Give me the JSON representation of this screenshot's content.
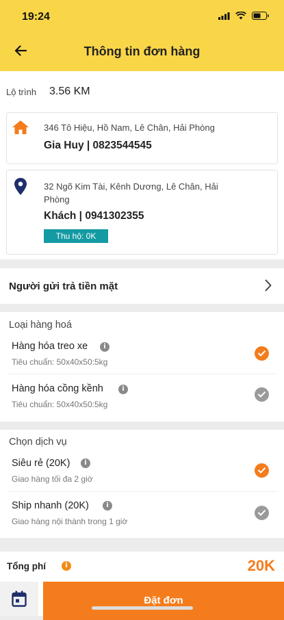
{
  "status_bar": {
    "time": "19:24"
  },
  "header": {
    "title": "Thông tin đơn hàng"
  },
  "route": {
    "label": "Lộ trình",
    "distance": "3.56 KM"
  },
  "pickup": {
    "address": "346 Tô Hiệu, Hồ Nam, Lê Chân, Hải Phòng",
    "contact": "Gia Huy | 0823544545",
    "icon": "home-icon"
  },
  "dropoff": {
    "address_line1": "32 Ngõ Kim Tài, Kênh Dương, Lê Chân, Hải",
    "address_line2": "Phòng",
    "contact": "Khách  | 0941302355",
    "cod_badge": "Thu hộ:  0K",
    "icon": "location-pin-icon"
  },
  "payment": {
    "label": "Người gửi trả tiền mặt"
  },
  "goods": {
    "title": "Loại hàng hoá",
    "options": [
      {
        "title": "Hàng hóa treo xe",
        "sub": "Tiêu chuẩn: 50x40x50:5kg",
        "selected": true
      },
      {
        "title": "Hàng hóa cồng kềnh",
        "sub": "Tiêu chuẩn: 50x40x50:5kg",
        "selected": false
      }
    ]
  },
  "service": {
    "title": "Chọn dịch vụ",
    "options": [
      {
        "title": "Siêu rẻ (20K)",
        "sub": "Giao hàng tối đa 2 giờ",
        "selected": true
      },
      {
        "title": "Ship nhanh (20K)",
        "sub": "Giao hàng nội thành trong 1 giờ",
        "selected": false
      }
    ]
  },
  "summary": {
    "total_label": "Tổng phí",
    "total_value": "20K",
    "order_button": "Đặt đơn"
  },
  "colors": {
    "brand_yellow": "#f9d648",
    "accent_orange": "#f47c1c",
    "teal": "#149aa3",
    "navy": "#1f2f6b"
  }
}
